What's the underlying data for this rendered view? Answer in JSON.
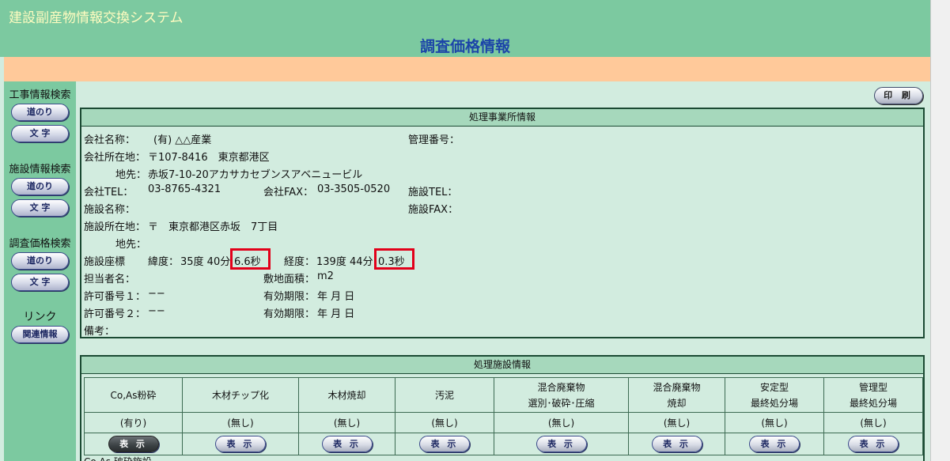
{
  "header": {
    "system_title": "建設副産物情報交換システム",
    "page_title": "調査価格情報"
  },
  "sidebar": {
    "sections": [
      {
        "label": "工事情報検索",
        "buttons": [
          "道のり",
          "文 字"
        ]
      },
      {
        "label": "施設情報検索",
        "buttons": [
          "道のり",
          "文 字"
        ]
      },
      {
        "label": "調査価格検索",
        "buttons": [
          "道のり",
          "文 字"
        ]
      }
    ],
    "link_label": "リンク",
    "link_button": "関連情報"
  },
  "print_button": "印 刷",
  "office": {
    "header": "処理事業所情報",
    "company_name_label": "会社名称：",
    "company_name": "(有) △△産業",
    "management_no_label": "管理番号：",
    "management_no": "",
    "company_address_label": "会社所在地：",
    "company_address": "〒107-8416　東京都港区",
    "address_detail_label": "地先：",
    "address_detail": "赤坂7-10-20アカサカセブンスアベニュービル",
    "company_tel_label": "会社TEL：",
    "company_tel": "03-8765-4321",
    "company_fax_label": "会社FAX：",
    "company_fax": "03-3505-0520",
    "facility_tel_label": "施設TEL：",
    "facility_tel": "",
    "facility_name_label": "施設名称：",
    "facility_name": "",
    "facility_fax_label": "施設FAX：",
    "facility_fax": "",
    "facility_address_label": "施設所在地：",
    "facility_address": "〒　東京都港区赤坂　7丁目",
    "facility_detail_label": "地先：",
    "facility_detail": "",
    "coords_label": "施設座標",
    "latitude_label": "緯度：",
    "latitude_dm": "35度 40分",
    "latitude_sec": "6.6秒",
    "longitude_label": "経度：",
    "longitude_dm": "139度 44分",
    "longitude_sec": "0.3秒",
    "person_label": "担当者名：",
    "person": "",
    "site_area_label": "敷地面積：",
    "site_area": "m2",
    "permit1_label": "許可番号１：",
    "permit1": "−−",
    "validity1_label": "有効期限：",
    "validity1": "年 月 日",
    "permit2_label": "許可番号２：",
    "permit2": "−−",
    "validity2_label": "有効期限：",
    "validity2": "年 月 日",
    "remarks_label": "備考：",
    "remarks": "",
    "highlight_color": "#e2001a"
  },
  "facility": {
    "header": "処理施設情報",
    "columns": [
      {
        "name": [
          "Co,As粉砕"
        ],
        "status": "(有り)",
        "button": "表 示",
        "active": true
      },
      {
        "name": [
          "木材チップ化"
        ],
        "status": "(無し)",
        "button": "表 示",
        "active": false
      },
      {
        "name": [
          "木材焼却"
        ],
        "status": "(無し)",
        "button": "表 示",
        "active": false
      },
      {
        "name": [
          "汚泥"
        ],
        "status": "(無し)",
        "button": "表 示",
        "active": false
      },
      {
        "name": [
          "混合廃棄物",
          "選別･破砕･圧縮"
        ],
        "status": "(無し)",
        "button": "表 示",
        "active": false
      },
      {
        "name": [
          "混合廃棄物",
          "焼却"
        ],
        "status": "(無し)",
        "button": "表 示",
        "active": false
      },
      {
        "name": [
          "安定型",
          "最終処分場"
        ],
        "status": "(無し)",
        "button": "表 示",
        "active": false
      },
      {
        "name": [
          "管理型",
          "最終処分場"
        ],
        "status": "(無し)",
        "button": "表 示",
        "active": false
      }
    ],
    "bottom_text": "Co,As 破砕施設"
  },
  "colors": {
    "header_bg": "#7cc9a0",
    "system_title": "#fffcc0",
    "page_title": "#1c45a8",
    "orange_bar": "#ffc99a",
    "content_bg": "#d2ecdf"
  }
}
